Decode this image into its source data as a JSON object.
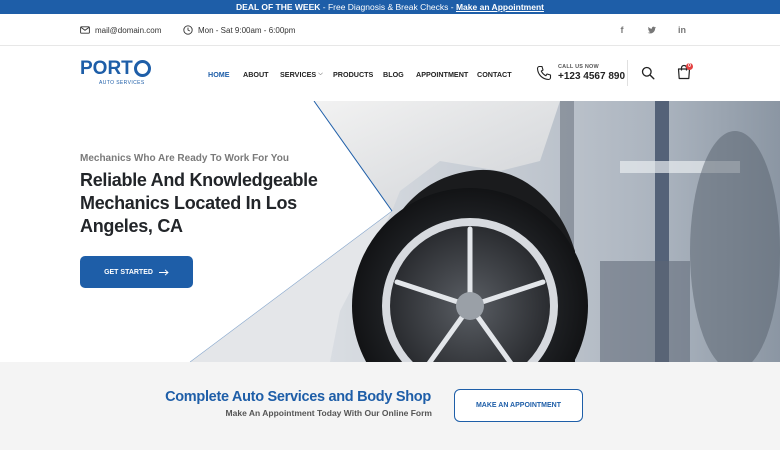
{
  "promo": {
    "lead": "DEAL OF THE WEEK",
    "middle": " - Free Diagnosis & Break Checks - ",
    "link": "Make an Appointment"
  },
  "topbar": {
    "email": "mail@domain.com",
    "hours": "Mon - Sat 9:00am - 6:00pm",
    "social": [
      "facebook-icon",
      "twitter-icon",
      "linkedin-icon"
    ]
  },
  "brand": {
    "logo_text": "PORT",
    "logo_sub": "AUTO SERVICES",
    "accent": "#1e5ea8"
  },
  "nav": {
    "items": [
      "HOME",
      "ABOUT",
      "SERVICES",
      "PRODUCTS",
      "BLOG",
      "APPOINTMENT",
      "CONTACT"
    ],
    "active": "HOME"
  },
  "call": {
    "label": "CALL US NOW",
    "number": "+123 4567 890"
  },
  "cart": {
    "count": "0"
  },
  "hero": {
    "subtitle": "Mechanics Who Are Ready To Work For You",
    "title": "Reliable And Knowledgeable Mechanics Located In Los Angeles, CA",
    "button": "GET STARTED"
  },
  "cta": {
    "title": "Complete Auto Services and Body Shop",
    "subtitle": "Make An Appointment Today With Our Online Form",
    "button": "MAKE AN APPOINTMENT"
  }
}
